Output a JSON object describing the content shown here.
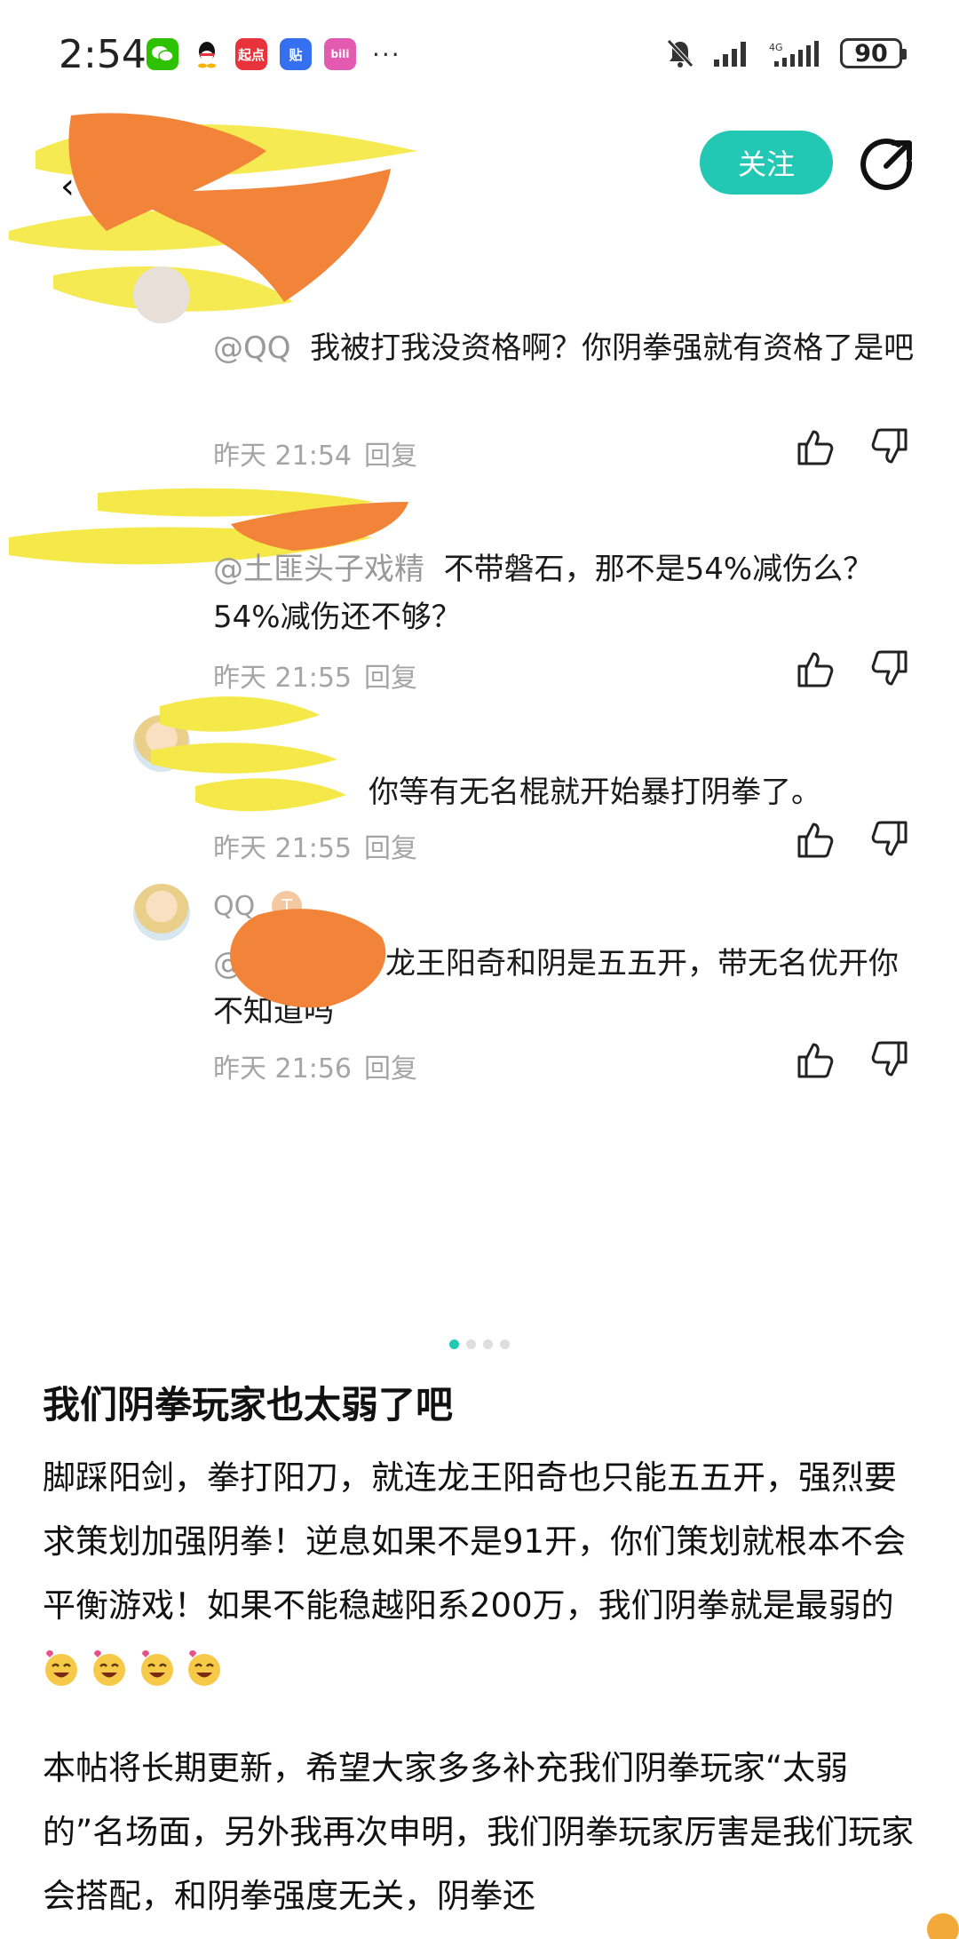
{
  "status_bar": {
    "time": "2:54",
    "apps": [
      {
        "name": "wechat-icon",
        "label": "",
        "color": "#2dc100"
      },
      {
        "name": "qq-icon",
        "label": "",
        "color": "#1a1a1a"
      },
      {
        "name": "qidian-icon",
        "label": "起点",
        "color": "#e8323c"
      },
      {
        "name": "tieba-icon",
        "label": "贴",
        "color": "#3470f0"
      },
      {
        "name": "bilibili-icon",
        "label": "bili",
        "color": "#e35bb0"
      }
    ],
    "more": "···",
    "battery": "90"
  },
  "header": {
    "follow_label": "关注"
  },
  "comments": [
    {
      "mention": "@QQ",
      "text": "我被打我没资格啊？你阴拳强就有资格了是吧",
      "time": "昨天 21:54",
      "reply_label": "回复"
    },
    {
      "mention": "@土匪头子戏精",
      "text": "不带磐石，那不是54%减伤么？54%减伤还不够？",
      "time": "昨天 21:55",
      "reply_label": "回复"
    },
    {
      "mention": "",
      "text": "你等有无名棍就开始暴打阴拳了。",
      "time": "昨天 21:55",
      "reply_label": "回复"
    },
    {
      "username": "QQ",
      "level": "T",
      "mention": "@",
      "text": "龙王阳奇和阴是五五开，带无名优开你不知道吗",
      "time": "昨天 21:56",
      "reply_label": "回复"
    }
  ],
  "pager": {
    "count": 4,
    "active": 0
  },
  "post": {
    "title": "我们阴拳玩家也太弱了吧",
    "paragraph1": "脚踩阳剑，拳打阳刀，就连龙王阳奇也只能五五开，强烈要求策划加强阴拳！逆息如果不是91开，你们策划就根本不会平衡游戏！如果不能稳越阳系200万，我们阴拳就是最弱的",
    "paragraph2": "本帖将长期更新，希望大家多多补充我们阴拳玩家“太弱的”名场面，另外我再次申明，我们阴拳玩家厉害是我们玩家会搭配，和阴拳强度无关，阴拳还"
  },
  "colors": {
    "accent": "#23c8b4",
    "meta_gray": "#a5a5a5",
    "scribble_yellow": "#f5e94a",
    "scribble_orange": "#f2843a"
  }
}
